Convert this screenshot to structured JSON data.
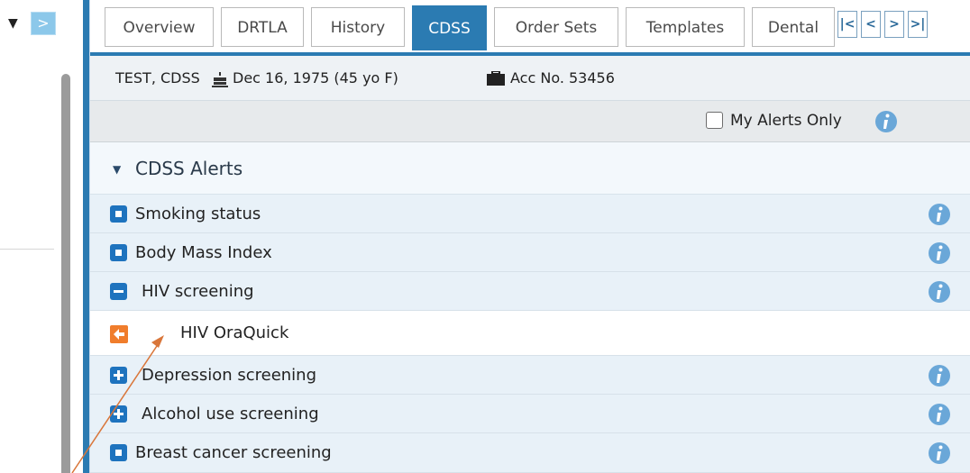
{
  "tabs": [
    {
      "label": "Overview",
      "active": false
    },
    {
      "label": "DRTLA",
      "active": false
    },
    {
      "label": "History",
      "active": false
    },
    {
      "label": "CDSS",
      "active": true
    },
    {
      "label": "Order Sets",
      "active": false
    },
    {
      "label": "Templates",
      "active": false
    },
    {
      "label": "Dental",
      "active": false
    }
  ],
  "tab_nav": {
    "first": "|<",
    "prev": "<",
    "next": ">",
    "last": ">|"
  },
  "patient": {
    "name": "TEST, CDSS",
    "dob": "Dec 16, 1975 (45 yo F)",
    "account": "Acc No. 53456",
    "dob_icon": "birthday-cake-icon",
    "account_icon": "briefcase-icon"
  },
  "filter": {
    "my_alerts_label": "My Alerts Only",
    "my_alerts_checked": false
  },
  "section": {
    "title": "CDSS Alerts",
    "expanded": true
  },
  "alerts": [
    {
      "label": "Smoking status",
      "icon": "square-bullet-icon",
      "info": true
    },
    {
      "label": "Body Mass Index",
      "icon": "square-bullet-icon",
      "info": true
    },
    {
      "label": "HIV screening",
      "icon": "collapse-minus-icon",
      "info": true
    },
    {
      "label": "HIV OraQuick",
      "icon": "orange-arrow-left-icon",
      "info": false,
      "sub": true
    },
    {
      "label": "Depression screening",
      "icon": "expand-plus-icon",
      "info": true
    },
    {
      "label": "Alcohol use screening",
      "icon": "expand-plus-icon",
      "info": true
    },
    {
      "label": "Breast cancer screening",
      "icon": "square-bullet-icon",
      "info": true
    }
  ],
  "colors": {
    "accent": "#2b7bb2",
    "icon_blue": "#1e73be",
    "info_blue": "#6aa7d8",
    "highlight_orange": "#f07d2c",
    "annotation_arrow": "#d9763a"
  }
}
